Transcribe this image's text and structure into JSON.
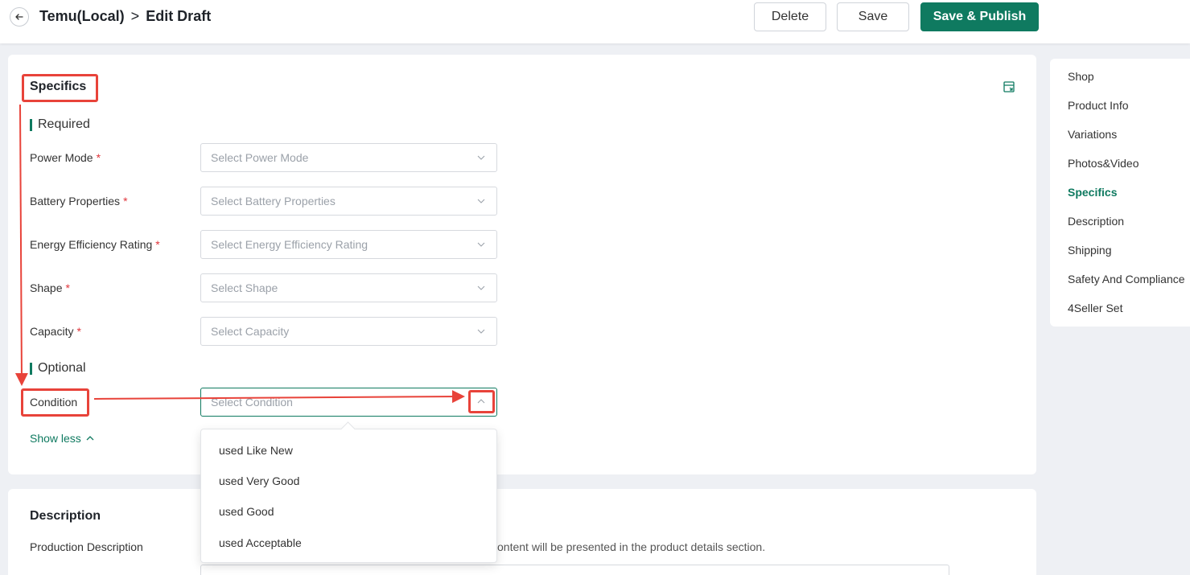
{
  "header": {
    "app_name": "Temu(Local)",
    "separator": ">",
    "page_title": "Edit Draft",
    "delete_label": "Delete",
    "save_label": "Save",
    "publish_label": "Save & Publish"
  },
  "specifics": {
    "title": "Specifics",
    "required_label": "Required",
    "optional_label": "Optional",
    "required_fields": [
      {
        "label": "Power Mode",
        "required_mark": "*",
        "placeholder": "Select Power Mode"
      },
      {
        "label": "Battery Properties",
        "required_mark": "*",
        "placeholder": "Select Battery Properties"
      },
      {
        "label": "Energy Efficiency Rating",
        "required_mark": "*",
        "placeholder": "Select Energy Efficiency Rating"
      },
      {
        "label": "Shape",
        "required_mark": "*",
        "placeholder": "Select Shape"
      },
      {
        "label": "Capacity",
        "required_mark": "*",
        "placeholder": "Select Capacity"
      }
    ],
    "optional_fields": [
      {
        "label": "Condition",
        "placeholder": "Select Condition"
      }
    ],
    "show_less_label": "Show less",
    "condition_options": [
      "used Like New",
      "used Very Good",
      "used Good",
      "used Acceptable"
    ]
  },
  "description": {
    "title": "Description",
    "production_label": "Production Description",
    "hint_text": "ontent will be presented in the product details section."
  },
  "side_nav": {
    "items": [
      "Shop",
      "Product Info",
      "Variations",
      "Photos&Video",
      "Specifics",
      "Description",
      "Shipping",
      "Safety And Compliance",
      "4Seller Set"
    ],
    "active_item": "Specifics"
  },
  "colors": {
    "accent": "#0f7a60",
    "required": "#e0353b",
    "annotation": "#e8433a"
  }
}
